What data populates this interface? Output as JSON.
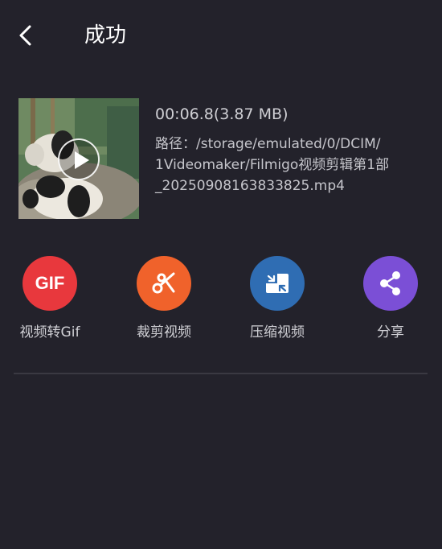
{
  "header": {
    "title": "成功"
  },
  "video": {
    "duration_size": "00:06.8(3.87 MB)",
    "path_line1": "路径：/storage/emulated/0/DCIM/",
    "path_line2": "1Videomaker/Filmigo视频剪辑第1部",
    "path_line3": "_20250908163833825.mp4"
  },
  "actions": [
    {
      "label": "视频转Gif",
      "icon": "gif-icon",
      "color": "#e8383d",
      "icon_text": "GIF"
    },
    {
      "label": "裁剪视频",
      "icon": "scissors-icon",
      "color": "#f0622b"
    },
    {
      "label": "压缩视频",
      "icon": "compress-icon",
      "color": "#2f6db3"
    },
    {
      "label": "分享",
      "icon": "share-icon",
      "color": "#7b4fd6"
    }
  ],
  "colors": {
    "background": "#23222b",
    "divider": "#3a3942"
  }
}
